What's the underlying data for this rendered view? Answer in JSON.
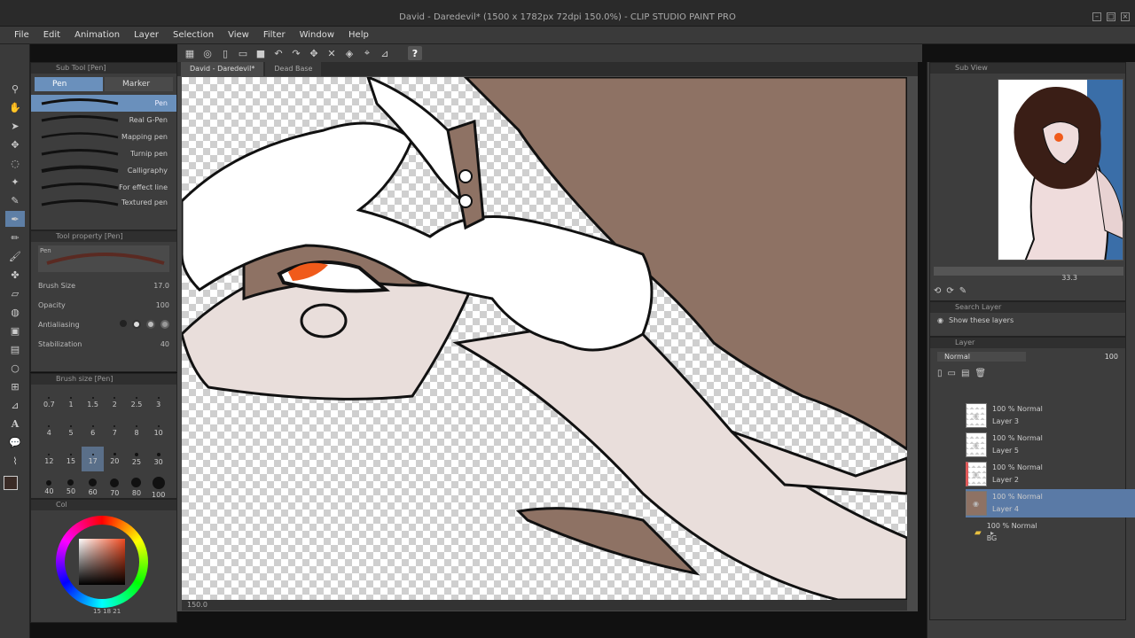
{
  "window": {
    "title": "David - Daredevil* (1500 x 1782px 72dpi 150.0%) - CLIP STUDIO PAINT PRO"
  },
  "menu": [
    "File",
    "Edit",
    "Animation",
    "Layer",
    "Selection",
    "View",
    "Filter",
    "Window",
    "Help"
  ],
  "doc_tabs": [
    "David - Daredevil*",
    "Dead Base"
  ],
  "subtool": {
    "title": "Sub Tool [Pen]",
    "tabs": [
      "Pen",
      "Marker"
    ],
    "brushes": [
      "Pen",
      "Real G-Pen",
      "Mapping pen",
      "Turnip pen",
      "Calligraphy",
      "For effect line",
      "Textured pen"
    ]
  },
  "tool_property": {
    "title": "Tool property [Pen]",
    "preset_name": "Pen",
    "brush_size_label": "Brush Size",
    "brush_size_value": "17.0",
    "opacity_label": "Opacity",
    "opacity_value": "100",
    "antialiasing_label": "Antialiasing",
    "stabilization_label": "Stabilization",
    "stabilization_value": "40"
  },
  "brush_size_panel": {
    "title": "Brush size [Pen]",
    "sizes": [
      "0.7",
      "1",
      "1.5",
      "2",
      "2.5",
      "3",
      "4",
      "5",
      "6",
      "7",
      "8",
      "10",
      "12",
      "15",
      "17",
      "20",
      "25",
      "30",
      "40",
      "50",
      "60",
      "70",
      "80",
      "100"
    ],
    "active": "17"
  },
  "color_panel": {
    "title": "Col",
    "readout": "15  18  21"
  },
  "canvas": {
    "zoom_label": "150.0"
  },
  "sub_view": {
    "title": "Sub View",
    "zoom_value": "33.3"
  },
  "search_layer": {
    "title": "Search Layer",
    "show_label": "Show these layers"
  },
  "layer_panel": {
    "title": "Layer",
    "blend_mode": "Normal",
    "opacity": "100",
    "layers": [
      {
        "mode": "100 % Normal",
        "name": "Layer 3"
      },
      {
        "mode": "100 % Normal",
        "name": "Layer 5"
      },
      {
        "mode": "100 % Normal",
        "name": "Layer 2"
      },
      {
        "mode": "100 % Normal",
        "name": "Layer 4"
      },
      {
        "mode": "100 % Normal",
        "name": "BG"
      }
    ]
  },
  "colors": {
    "accent": "#6a90bc",
    "fur_brown": "#8e7264",
    "skin_pink": "#e9dedb",
    "eye_orange": "#f05a1a"
  }
}
